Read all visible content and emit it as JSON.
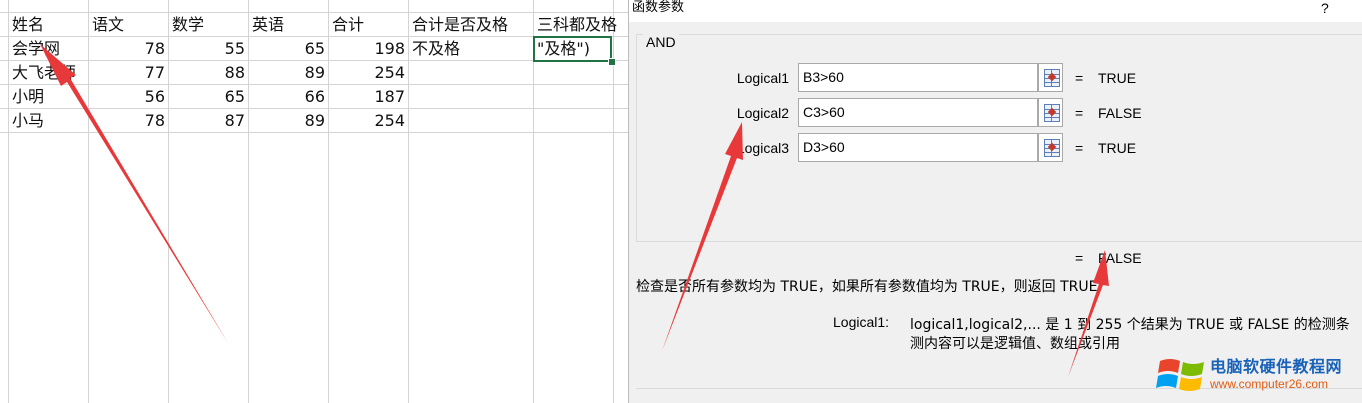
{
  "sheet": {
    "headers": [
      "姓名",
      "语文",
      "数学",
      "英语",
      "合计",
      "合计是否及格",
      "三科都及格"
    ],
    "rows": [
      {
        "name": "会学网",
        "chinese": "78",
        "math": "55",
        "english": "65",
        "total": "198",
        "pass_total": "不及格",
        "pass_all": "\"及格\")"
      },
      {
        "name": "大飞老师",
        "chinese": "77",
        "math": "88",
        "english": "89",
        "total": "254",
        "pass_total": "",
        "pass_all": ""
      },
      {
        "name": "小明",
        "chinese": "56",
        "math": "65",
        "english": "66",
        "total": "187",
        "pass_total": "",
        "pass_all": ""
      },
      {
        "name": "小马",
        "chinese": "78",
        "math": "87",
        "english": "89",
        "total": "254",
        "pass_total": "",
        "pass_all": ""
      }
    ]
  },
  "dialog": {
    "title": "函数参数",
    "help": "?",
    "function_name": "AND",
    "args": [
      {
        "label": "Logical1",
        "value": "B3>60",
        "result": "TRUE"
      },
      {
        "label": "Logical2",
        "value": "C3>60",
        "result": "FALSE"
      },
      {
        "label": "Logical3",
        "value": "D3>60",
        "result": "TRUE"
      }
    ],
    "equals": "=",
    "overall_result": "FALSE",
    "description": "检查是否所有参数均为 TRUE，如果所有参数值均为 TRUE，则返回 TRUE",
    "arg_help_name": "Logical1:",
    "arg_help_line1": "logical1,logical2,... 是 1 到 255 个结果为 TRUE 或 FALSE 的检测条",
    "arg_help_line2": "测内容可以是逻辑值、数组或引用"
  },
  "watermark": {
    "title": "电脑软硬件教程网",
    "url": "www.computer26.com"
  },
  "colors": {
    "accent_green": "#217346",
    "annotation_red": "#e8393a"
  }
}
